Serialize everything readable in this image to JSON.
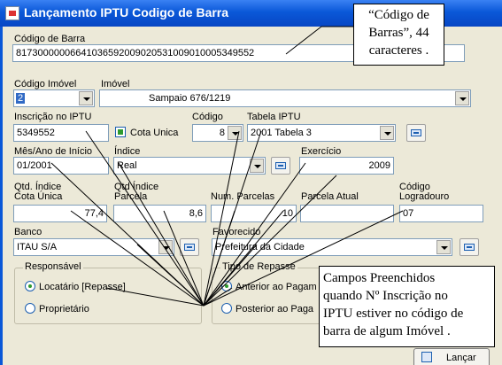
{
  "window": {
    "title": "Lançamento IPTU Codigo de Barra"
  },
  "codigo_barra": {
    "label": "Código de Barra",
    "value": "81730000006641036592009020531009010005349552"
  },
  "codigo_imovel": {
    "label": "Código Imóvel",
    "value": "2"
  },
  "imovel": {
    "label": "Imóvel",
    "value": "Sampaio 676/1219"
  },
  "inscricao": {
    "label": "Inscrição no IPTU",
    "value": "5349552"
  },
  "cota_unica": {
    "label": "Cota Unica",
    "checked": true
  },
  "codigo": {
    "label": "Código",
    "value": "8"
  },
  "tabela_iptu": {
    "label": "Tabela IPTU",
    "value": "2001 Tabela 3"
  },
  "mes_ano_inicio": {
    "label": "Mês/Ano de Início",
    "value": "01/2001"
  },
  "indice": {
    "label": "Índice",
    "value": "Real"
  },
  "exercicio": {
    "label": "Exercício",
    "value": "2009"
  },
  "qtd_indice_cota_unica": {
    "label_line1": "Qtd. Índice",
    "label_line2": "Cota Única",
    "value": "77,4"
  },
  "qtd_indice_parcela": {
    "label_line1": "Qtd Índice",
    "label_line2": "Parcela",
    "value": "8,6"
  },
  "num_parcelas": {
    "label": "Num. Parcelas",
    "value": "10"
  },
  "parcela_atual": {
    "label": "Parcela Atual",
    "value": ""
  },
  "codigo_logradouro": {
    "label_line1": "Código",
    "label_line2": "Logradouro",
    "value": "07"
  },
  "banco": {
    "label": "Banco",
    "value": "ITAU S/A"
  },
  "favorecido": {
    "label": "Favorecido",
    "value": "Prefeitura da Cidade"
  },
  "responsavel": {
    "legend": "Responsável",
    "options": [
      "Locatário [Repasse]",
      "Proprietário"
    ],
    "selected": 0
  },
  "tipo_repasse": {
    "legend": "Tipo de Repasse",
    "options": [
      "Anterior ao Pagam",
      "Posterior ao Paga"
    ],
    "selected": 0
  },
  "lancar_button": {
    "label": "Lançar"
  },
  "annotations": {
    "top_note": [
      "“Código de",
      "Barras”, 44",
      "caracteres ."
    ],
    "bottom_note": [
      "Campos Preenchidos",
      "quando Nº Inscrição no",
      "IPTU estiver no código de",
      "barra de algum Imóvel ."
    ]
  },
  "colors": {
    "titlebar": "#0a58d8",
    "window_bg": "#ece9d8",
    "selection": "#316ac5",
    "radio_dot": "#2e9a2e"
  }
}
